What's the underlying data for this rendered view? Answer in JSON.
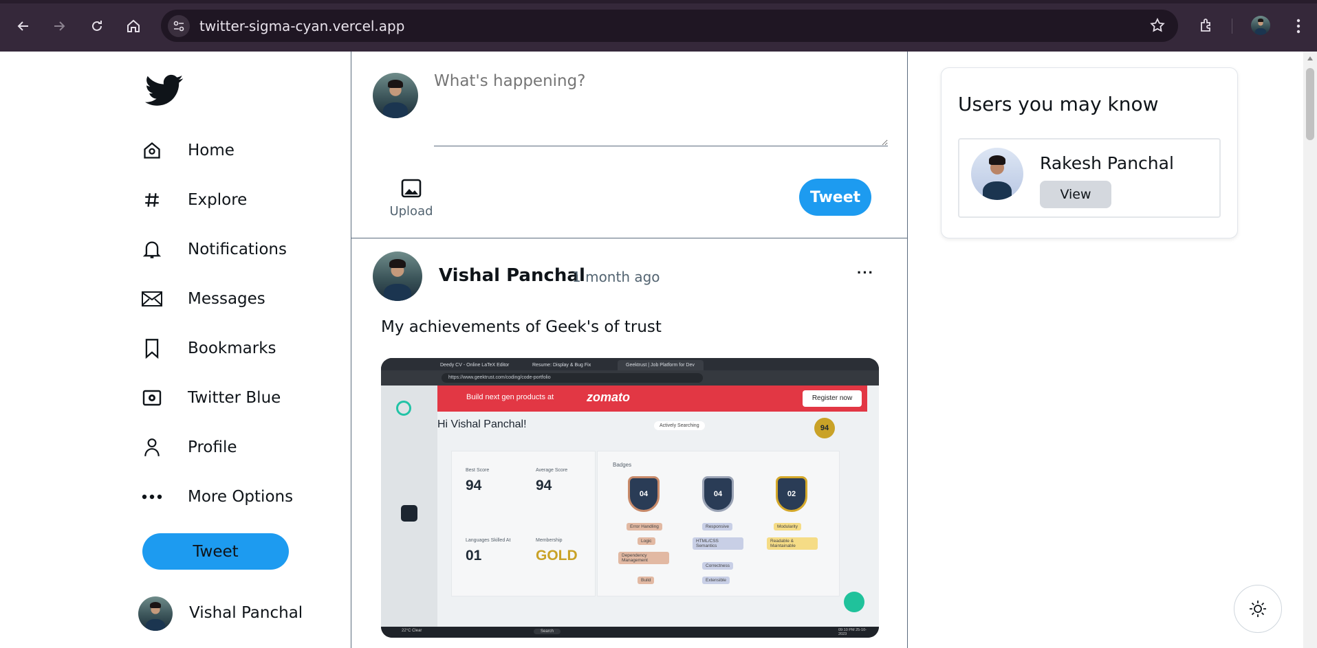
{
  "browser": {
    "url": "twitter-sigma-cyan.vercel.app",
    "icons": [
      "back-icon",
      "forward-icon",
      "reload-icon",
      "home-icon",
      "site-info-icon",
      "bookmark-star-icon",
      "extensions-icon",
      "profile-avatar",
      "menu-icon"
    ]
  },
  "sidebar": {
    "items": [
      {
        "label": "Home",
        "icon": "home-icon"
      },
      {
        "label": "Explore",
        "icon": "hashtag-icon"
      },
      {
        "label": "Notifications",
        "icon": "bell-icon"
      },
      {
        "label": "Messages",
        "icon": "envelope-icon"
      },
      {
        "label": "Bookmarks",
        "icon": "bookmark-icon"
      },
      {
        "label": "Twitter Blue",
        "icon": "twitter-blue-icon"
      },
      {
        "label": "Profile",
        "icon": "person-icon"
      },
      {
        "label": "More Options",
        "icon": "ellipsis-icon"
      }
    ],
    "tweet_button": "Tweet",
    "user_name": "Vishal Panchal"
  },
  "composer": {
    "placeholder": "What's happening?",
    "upload_label": "Upload",
    "tweet_button": "Tweet"
  },
  "post": {
    "author": "Vishal Panchal",
    "time": "1 month ago",
    "more": "···",
    "text": "My achievements of Geek's of trust",
    "image": {
      "tabs": [
        "Deedy CV - Online LaTeX Editor",
        "Resume: Display & Bug Fix",
        "Geektrust | Job Platform for Dev"
      ],
      "url": "https://www.geektrust.com/coding/code-portfolio",
      "banner_text": "Build next gen products at",
      "banner_brand": "zomato",
      "register": "Register now",
      "greeting": "Hi Vishal Panchal!",
      "status": "Actively Searching",
      "best_score_label": "Best Score",
      "best_score": "94",
      "avg_score_label": "Average Score",
      "avg_score": "94",
      "langs_label": "Languages Skilled At",
      "langs": "01",
      "membership_label": "Membership",
      "membership": "GOLD",
      "badges_label": "Badges",
      "badge_values": [
        "04",
        "04",
        "02"
      ],
      "chips_col1": [
        "Error Handling",
        "Logic",
        "Dependency Management",
        "Build"
      ],
      "chips_col2": [
        "Responsive",
        "HTML/CSS Semantics",
        "Correctness",
        "Extensible"
      ],
      "chips_col3": [
        "Modularity",
        "Readable & Maintainable"
      ],
      "weather": "22°C Clear",
      "search": "Search",
      "clock": "09:10 PM 25-10-2023"
    }
  },
  "suggestions": {
    "title": "Users you may know",
    "users": [
      {
        "name": "Rakesh Panchal",
        "button": "View"
      }
    ]
  },
  "colors": {
    "accent": "#1d9bf0",
    "chrome": "#35283a"
  }
}
